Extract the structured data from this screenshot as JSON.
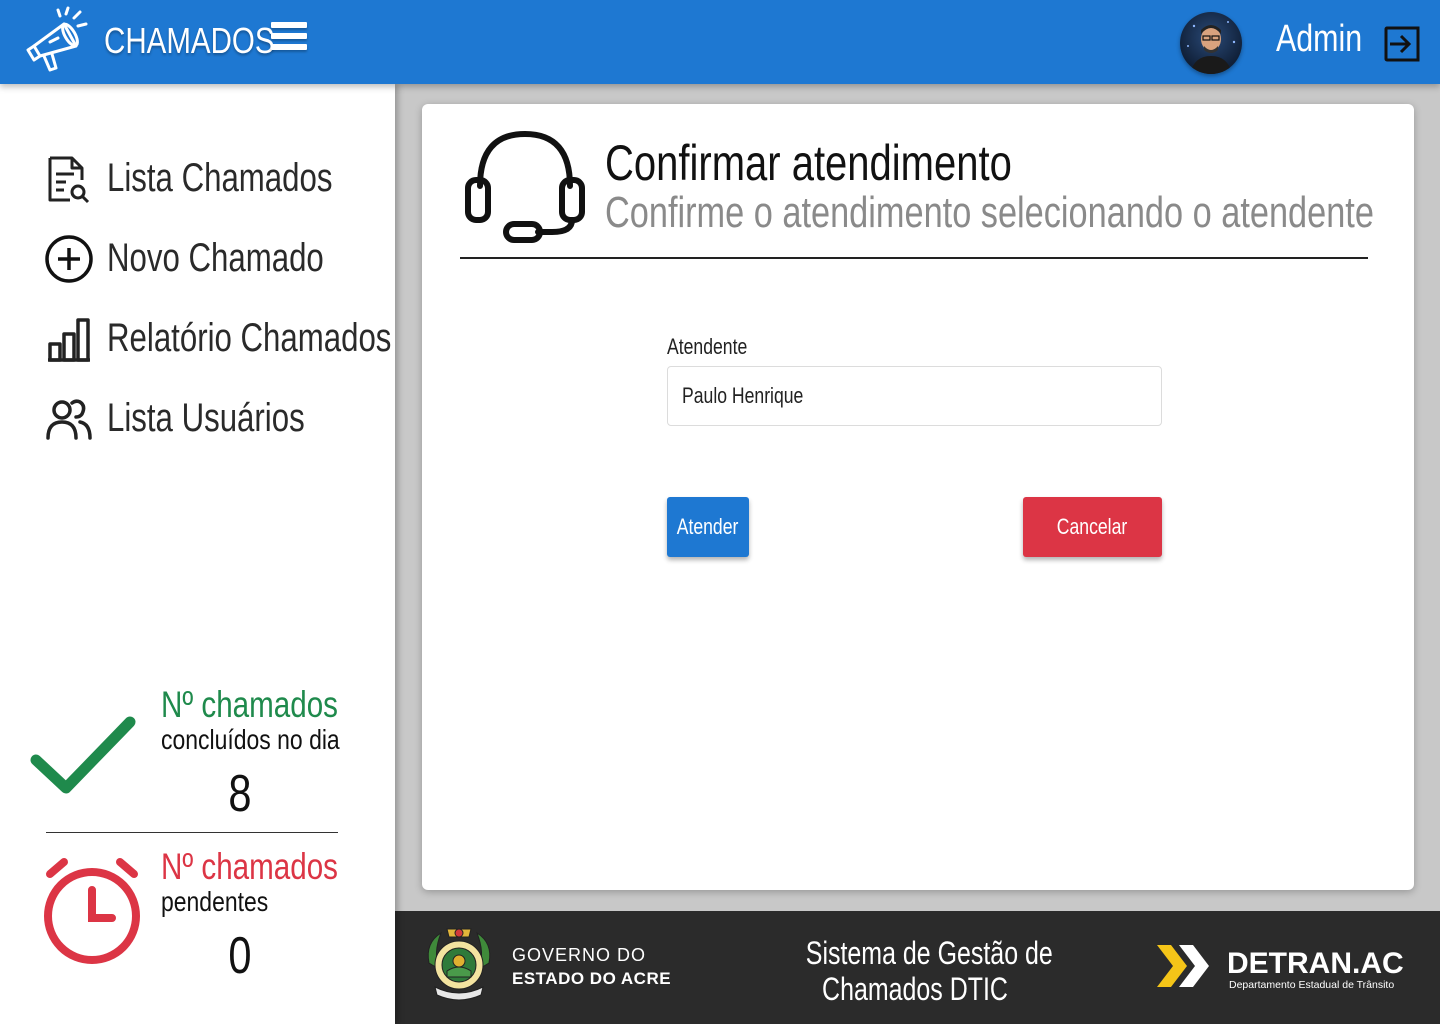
{
  "header": {
    "app_title": "CHAMADOS",
    "user_name": "Admin"
  },
  "sidebar": {
    "items": [
      {
        "label": "Lista Chamados",
        "icon": "file-search-icon"
      },
      {
        "label": "Novo Chamado",
        "icon": "plus-circle-icon"
      },
      {
        "label": "Relatório Chamados",
        "icon": "bar-chart-icon"
      },
      {
        "label": "Lista Usuários",
        "icon": "users-icon"
      }
    ],
    "stats": {
      "done": {
        "title": "Nº chamados",
        "subtitle": "concluídos no dia",
        "value": "8"
      },
      "pending": {
        "title": "Nº chamados",
        "subtitle": "pendentes",
        "value": "0"
      }
    }
  },
  "main": {
    "title": "Confirmar atendimento",
    "subtitle": "Confirme o atendimento selecionando o atendente",
    "field_label": "Atendente",
    "field_value": "Paulo Henrique",
    "confirm_label": "Atender",
    "cancel_label": "Cancelar"
  },
  "footer": {
    "gov_line1": "GOVERNO DO",
    "gov_line2": "ESTADO DO ACRE",
    "system_line1": "Sistema de Gestão de",
    "system_line2": "Chamados DTIC",
    "detran_name": "DETRAN.AC",
    "detran_sub": "Departamento Estadual de Trânsito"
  },
  "colors": {
    "primary": "#1e78d2",
    "danger": "#dc3545",
    "success": "#1f8a4c",
    "footer_bg": "#2b2b2b",
    "detran_yellow": "#f5c518"
  }
}
